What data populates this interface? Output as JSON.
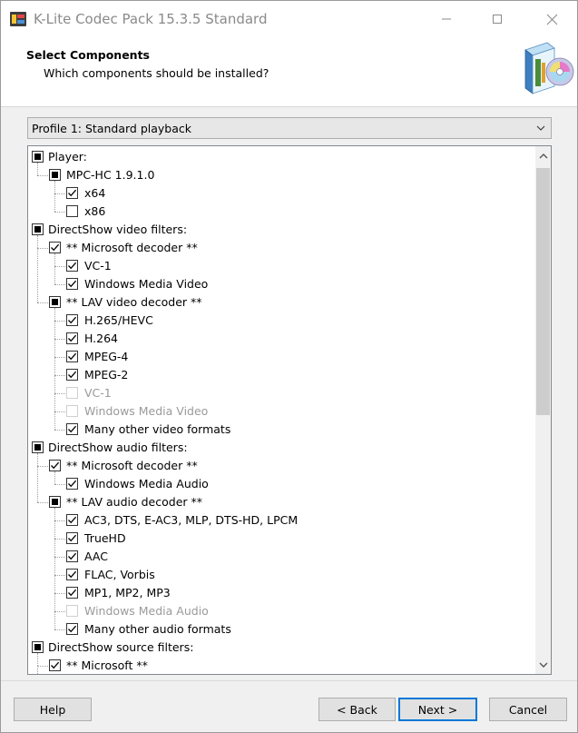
{
  "window": {
    "title": "K-Lite Codec Pack 15.3.5 Standard"
  },
  "header": {
    "title": "Select Components",
    "subtitle": "Which components should be installed?"
  },
  "profile": {
    "selected": "Profile 1: Standard playback"
  },
  "tree": [
    {
      "label": "Player:",
      "level": 0,
      "state": "partial"
    },
    {
      "label": "MPC-HC 1.9.1.0",
      "level": 1,
      "state": "partial"
    },
    {
      "label": "x64",
      "level": 2,
      "state": "checked"
    },
    {
      "label": "x86",
      "level": 2,
      "state": "unchecked"
    },
    {
      "label": "DirectShow video filters:",
      "level": 0,
      "state": "partial"
    },
    {
      "label": "**  Microsoft decoder  **",
      "level": 1,
      "state": "checked"
    },
    {
      "label": "VC-1",
      "level": 2,
      "state": "checked"
    },
    {
      "label": "Windows Media Video",
      "level": 2,
      "state": "checked"
    },
    {
      "label": "**  LAV video decoder  **",
      "level": 1,
      "state": "partial"
    },
    {
      "label": "H.265/HEVC",
      "level": 2,
      "state": "checked"
    },
    {
      "label": "H.264",
      "level": 2,
      "state": "checked"
    },
    {
      "label": "MPEG-4",
      "level": 2,
      "state": "checked"
    },
    {
      "label": "MPEG-2",
      "level": 2,
      "state": "checked"
    },
    {
      "label": "VC-1",
      "level": 2,
      "state": "disabled"
    },
    {
      "label": "Windows Media Video",
      "level": 2,
      "state": "disabled"
    },
    {
      "label": "Many other video formats",
      "level": 2,
      "state": "checked"
    },
    {
      "label": "DirectShow audio filters:",
      "level": 0,
      "state": "partial"
    },
    {
      "label": "**  Microsoft decoder  **",
      "level": 1,
      "state": "checked"
    },
    {
      "label": "Windows Media Audio",
      "level": 2,
      "state": "checked"
    },
    {
      "label": "**  LAV audio decoder  **",
      "level": 1,
      "state": "partial"
    },
    {
      "label": "AC3, DTS, E-AC3, MLP, DTS-HD, LPCM",
      "level": 2,
      "state": "checked"
    },
    {
      "label": "TrueHD",
      "level": 2,
      "state": "checked"
    },
    {
      "label": "AAC",
      "level": 2,
      "state": "checked"
    },
    {
      "label": "FLAC, Vorbis",
      "level": 2,
      "state": "checked"
    },
    {
      "label": "MP1, MP2, MP3",
      "level": 2,
      "state": "checked"
    },
    {
      "label": "Windows Media Audio",
      "level": 2,
      "state": "disabled"
    },
    {
      "label": "Many other audio formats",
      "level": 2,
      "state": "checked"
    },
    {
      "label": "DirectShow source filters:",
      "level": 0,
      "state": "partial"
    },
    {
      "label": "**  Microsoft  **",
      "level": 1,
      "state": "checked"
    }
  ],
  "buttons": {
    "help": "Help",
    "back": "< Back",
    "next": "Next >",
    "cancel": "Cancel"
  },
  "icons": {
    "app": "k-lite-app-icon",
    "logo": "software-box-cd-icon",
    "minimize": "minimize-icon",
    "maximize": "maximize-icon",
    "close": "close-icon",
    "dropdown": "chevron-down-icon",
    "scroll_up": "scroll-up-arrow-icon",
    "scroll_down": "scroll-down-arrow-icon",
    "check": "checkmark-icon"
  },
  "colors": {
    "accent": "#0078d7",
    "window_bg": "#f0f0f0",
    "disabled_text": "#9a9a9a"
  }
}
